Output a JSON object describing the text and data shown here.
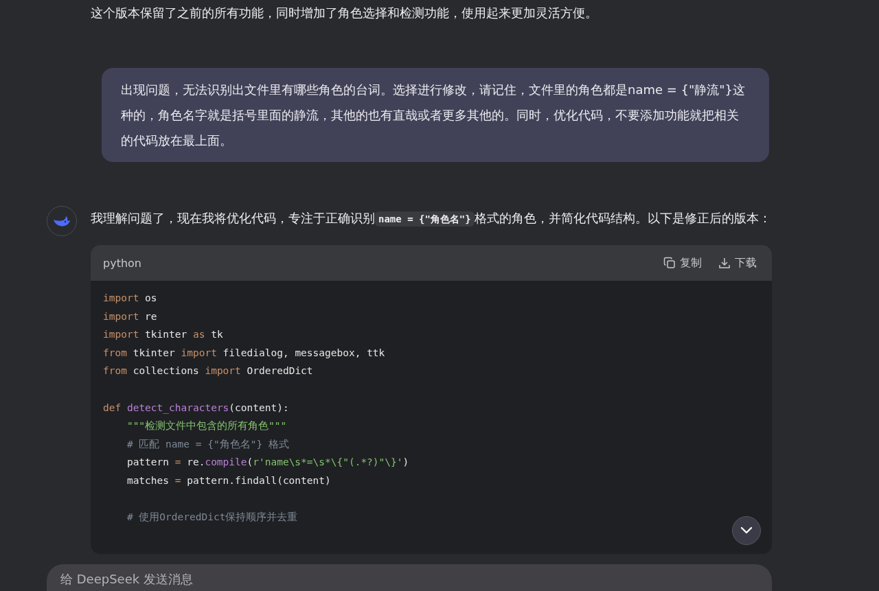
{
  "intro_text": "这个版本保留了之前的所有功能，同时增加了角色选择和检测功能，使用起来更加灵活方便。",
  "user_message": "出现问题，无法识别出文件里有哪些角色的台词。选择进行修改，请记住，文件里的角色都是name = {\"静流\"}这种的，角色名字就是括号里面的静流，其他的也有直哉或者更多其他的。同时，优化代码，不要添加功能就把相关的代码放在最上面。",
  "reply": {
    "before": "我理解问题了，现在我将优化代码，专注于正确识别",
    "code": "name = {\"角色名\"}",
    "after": "格式的角色，并简化代码结构。以下是修正后的版本："
  },
  "code_block": {
    "language": "python",
    "actions": [
      {
        "kind": "copy",
        "label": "复制"
      },
      {
        "kind": "download",
        "label": "下载"
      }
    ],
    "lines": [
      {
        "kind": "code",
        "tokens": [
          {
            "kind": "keyword",
            "text": "import"
          },
          {
            "kind": "plain",
            "text": " os"
          }
        ]
      },
      {
        "kind": "code",
        "tokens": [
          {
            "kind": "keyword",
            "text": "import"
          },
          {
            "kind": "plain",
            "text": " re"
          }
        ]
      },
      {
        "kind": "code",
        "tokens": [
          {
            "kind": "keyword",
            "text": "import"
          },
          {
            "kind": "plain",
            "text": " tkinter "
          },
          {
            "kind": "keyword",
            "text": "as"
          },
          {
            "kind": "plain",
            "text": " tk"
          }
        ]
      },
      {
        "kind": "code",
        "tokens": [
          {
            "kind": "keyword",
            "text": "from"
          },
          {
            "kind": "plain",
            "text": " tkinter "
          },
          {
            "kind": "keyword",
            "text": "import"
          },
          {
            "kind": "plain",
            "text": " filedialog, messagebox, ttk"
          }
        ]
      },
      {
        "kind": "code",
        "tokens": [
          {
            "kind": "keyword",
            "text": "from"
          },
          {
            "kind": "plain",
            "text": " collections "
          },
          {
            "kind": "keyword",
            "text": "import"
          },
          {
            "kind": "plain",
            "text": " OrderedDict"
          }
        ]
      },
      {
        "kind": "blank"
      },
      {
        "kind": "code",
        "tokens": [
          {
            "kind": "keyword",
            "text": "def"
          },
          {
            "kind": "function",
            "text": " detect_characters"
          },
          {
            "kind": "plain",
            "text": "(content):"
          }
        ],
        "children": [
          {
            "kind": "code",
            "tokens": [
              {
                "kind": "string",
                "text": "\"\"\"检测文件中包含的所有角色\"\"\""
              }
            ]
          },
          {
            "kind": "code",
            "tokens": [
              {
                "kind": "comment",
                "text": "# 匹配 name = {\"角色名\"} 格式"
              }
            ]
          },
          {
            "kind": "code",
            "tokens": [
              {
                "kind": "plain",
                "text": "pattern "
              },
              {
                "kind": "operator",
                "text": "="
              },
              {
                "kind": "plain",
                "text": " re."
              },
              {
                "kind": "function",
                "text": "compile"
              },
              {
                "kind": "plain",
                "text": "("
              },
              {
                "kind": "string",
                "text": "r'name\\s*=\\s*\\{\"(.*?)\"\\}'"
              },
              {
                "kind": "plain",
                "text": ")"
              }
            ]
          },
          {
            "kind": "code",
            "tokens": [
              {
                "kind": "plain",
                "text": "matches "
              },
              {
                "kind": "operator",
                "text": "="
              },
              {
                "kind": "plain",
                "text": " pattern.findall(content)"
              }
            ]
          },
          {
            "kind": "blank"
          },
          {
            "kind": "code",
            "tokens": [
              {
                "kind": "comment",
                "text": "# 使用OrderedDict保持顺序并去重"
              }
            ]
          }
        ]
      }
    ]
  },
  "composer": {
    "placeholder": "给 DeepSeek 发送消息"
  }
}
